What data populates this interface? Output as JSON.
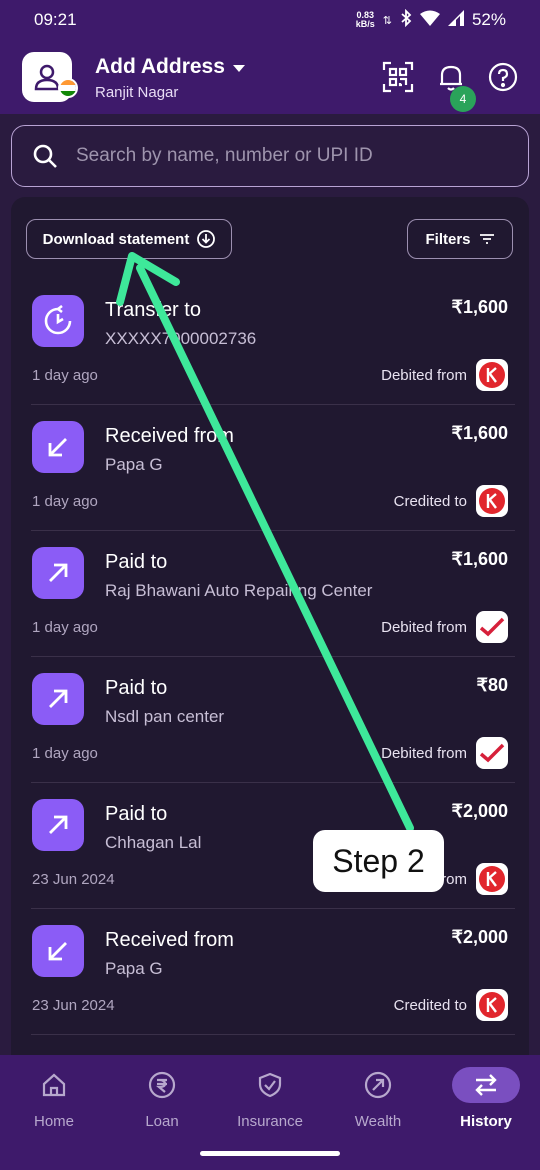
{
  "status": {
    "time": "09:21",
    "speed_value": "0.83",
    "speed_unit": "kB/s",
    "battery": "52%"
  },
  "header": {
    "title": "Add Address",
    "subtitle": "Ranjit Nagar",
    "notification_count": "4"
  },
  "search": {
    "placeholder": "Search by name, number or UPI ID"
  },
  "toolbar": {
    "download_label": "Download statement",
    "filters_label": "Filters"
  },
  "transactions": [
    {
      "title": "Transfer to",
      "party": "XXXXX7000002736",
      "amount": "₹1,600",
      "date": "1 day ago",
      "via": "Debited from",
      "type": "transfer",
      "bank": "kotak"
    },
    {
      "title": "Received from",
      "party": "Papa G",
      "amount": "₹1,600",
      "date": "1 day ago",
      "via": "Credited to",
      "type": "received",
      "bank": "kotak"
    },
    {
      "title": "Paid to",
      "party": "Raj Bhawani Auto Repairing Center",
      "amount": "₹1,600",
      "date": "1 day ago",
      "via": "Debited from",
      "type": "paid",
      "bank": "check"
    },
    {
      "title": "Paid to",
      "party": "Nsdl pan center",
      "amount": "₹80",
      "date": "1 day ago",
      "via": "Debited from",
      "type": "paid",
      "bank": "check"
    },
    {
      "title": "Paid to",
      "party": "Chhagan Lal",
      "amount": "₹2,000",
      "date": "23 Jun 2024",
      "via": "Debited from",
      "type": "paid",
      "bank": "kotak"
    },
    {
      "title": "Received from",
      "party": "Papa G",
      "amount": "₹2,000",
      "date": "23 Jun 2024",
      "via": "Credited to",
      "type": "received",
      "bank": "kotak"
    }
  ],
  "annotation": {
    "label": "Step 2",
    "color": "#3ee89a"
  },
  "nav": {
    "items": [
      {
        "label": "Home",
        "icon": "home-icon"
      },
      {
        "label": "Loan",
        "icon": "rupee-icon"
      },
      {
        "label": "Insurance",
        "icon": "shield-icon"
      },
      {
        "label": "Wealth",
        "icon": "wealth-icon"
      },
      {
        "label": "History",
        "icon": "history-icon",
        "active": true
      }
    ]
  },
  "colors": {
    "brand": "#3e1a6b",
    "accent": "#8b5cf6",
    "background": "#201830"
  }
}
